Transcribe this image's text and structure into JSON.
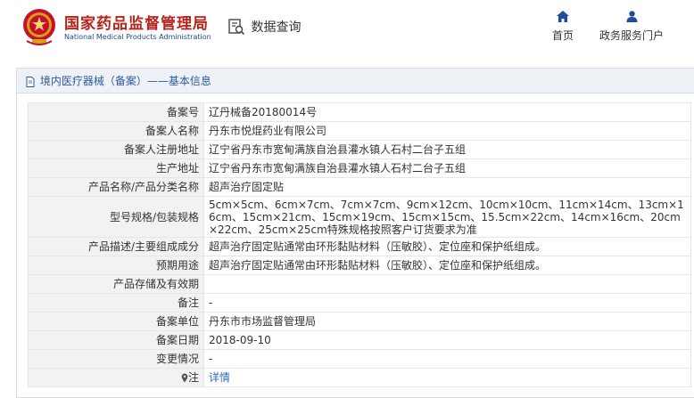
{
  "header": {
    "agency_cn": "国家药品监督管理局",
    "agency_en": "National Medical Products Administration",
    "query_label": "数据查询",
    "nav": {
      "home": "首页",
      "gov": "政务服务门户"
    }
  },
  "breadcrumb": {
    "text": "境内医疗器械（备案）——基本信息"
  },
  "rows": [
    {
      "key": "备案号",
      "value": "辽丹械备20180014号"
    },
    {
      "key": "备案人名称",
      "value": "丹东市悦焜药业有限公司"
    },
    {
      "key": "备案人注册地址",
      "value": "辽宁省丹东市宽甸满族自治县灌水镇人石村二台子五组"
    },
    {
      "key": "生产地址",
      "value": "辽宁省丹东市宽甸满族自治县灌水镇人石村二台子五组"
    },
    {
      "key": "产品名称/产品分类名称",
      "value": "超声治疗固定贴"
    },
    {
      "key": "型号规格/包装规格",
      "value": "5cm×5cm、6cm×7cm、7cm×7cm、9cm×12cm、10cm×10cm、11cm×14cm、13cm×16cm、15cm×21cm、15cm×19cm、15cm×15cm、15.5cm×22cm、14cm×16cm、20cm×22cm、25cm×25cm特殊规格按照客户订货要求为准"
    },
    {
      "key": "产品描述/主要组成成分",
      "value": "超声治疗固定贴通常由环形黏贴材料（压敏胶）、定位座和保护纸组成。"
    },
    {
      "key": "预期用途",
      "value": "超声治疗固定贴通常由环形黏贴材料（压敏胶）、定位座和保护纸组成。"
    },
    {
      "key": "产品存储及有效期",
      "value": ""
    },
    {
      "key": "备注",
      "value": "-"
    },
    {
      "key": "备案单位",
      "value": "丹东市市场监督管理局"
    },
    {
      "key": "备案日期",
      "value": "2018-09-10"
    },
    {
      "key": "变更情况",
      "value": "-"
    },
    {
      "key": "注",
      "value": "详情"
    }
  ],
  "colors": {
    "accent": "#b5241d",
    "link": "#2d6bc4",
    "header_label_bg": "#f2f2f2",
    "crumb_bg": "#eef2f7"
  },
  "icons": [
    "national-emblem",
    "query-icon",
    "home-icon",
    "user-icon",
    "document-icon",
    "pin-icon"
  ]
}
